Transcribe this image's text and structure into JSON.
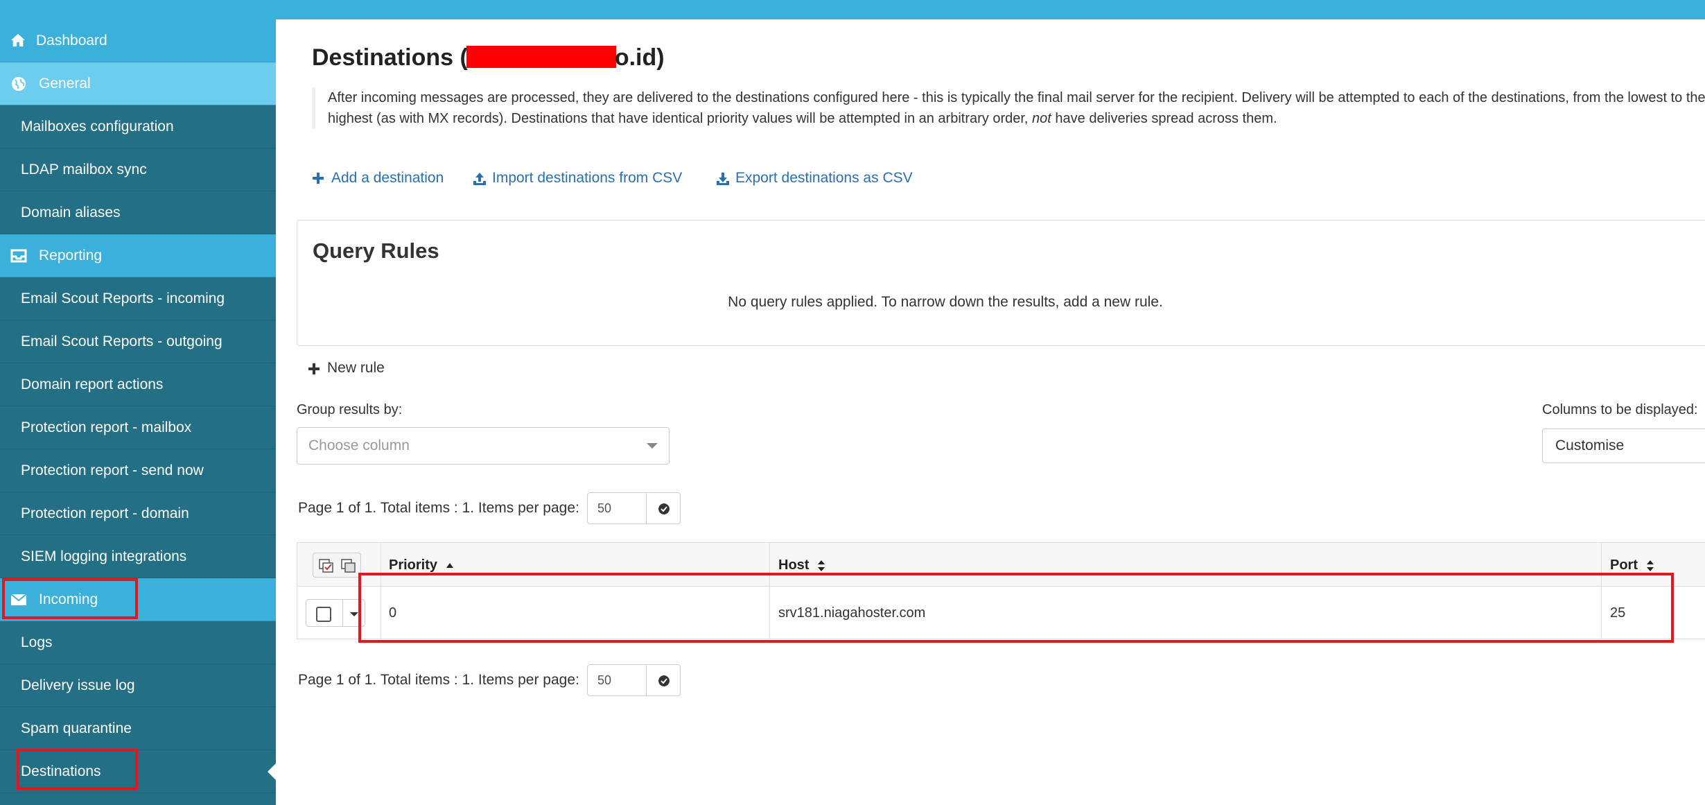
{
  "sidebar": {
    "dashboard": "Dashboard",
    "general": "General",
    "mailboxes_configuration": "Mailboxes configuration",
    "ldap_mailbox_sync": "LDAP mailbox sync",
    "domain_aliases": "Domain aliases",
    "reporting": "Reporting",
    "email_scout_incoming": "Email Scout Reports - incoming",
    "email_scout_outgoing": "Email Scout Reports - outgoing",
    "domain_report_actions": "Domain report actions",
    "protection_report_mailbox": "Protection report - mailbox",
    "protection_report_send_now": "Protection report - send now",
    "protection_report_domain": "Protection report - domain",
    "siem_logging": "SIEM logging integrations",
    "incoming": "Incoming",
    "logs": "Logs",
    "delivery_issue_log": "Delivery issue log",
    "spam_quarantine": "Spam quarantine",
    "destinations": "Destinations"
  },
  "page": {
    "title_prefix": "Destinations (",
    "title_suffix": "o.id)",
    "desc_line1_pre": "After incoming messages are processed, they are delivered to the destinations configured here - this is typically the final mail server for the recipient. Delivery will be attempted to each of the destinations, from the lowest to the",
    "desc_line2_pre": "highest (as with MX records). Destinations that have identical priority values will be attempted in an arbitrary order, ",
    "desc_line2_em": "not",
    "desc_line2_post": " have deliveries spread across them."
  },
  "actions": {
    "add": "Add a destination",
    "import": "Import destinations from CSV",
    "export": "Export destinations as CSV"
  },
  "query_rules": {
    "title": "Query Rules",
    "empty": "No query rules applied. To narrow down the results, add a new rule.",
    "new_rule": "New rule"
  },
  "group": {
    "label": "Group results by:",
    "placeholder": "Choose column"
  },
  "columns": {
    "label": "Columns to be displayed:",
    "value": "Customise"
  },
  "pager": {
    "text": "Page 1 of 1. Total items : 1. Items per page:",
    "per_page": "50"
  },
  "table": {
    "headers": {
      "priority": "Priority",
      "host": "Host",
      "port": "Port"
    },
    "rows": [
      {
        "priority": "0",
        "host": "srv181.niagahoster.com",
        "port": "25"
      }
    ]
  },
  "colors": {
    "topbar": "#3ab0db",
    "sidebar": "#236f86",
    "section": "#3ab0db",
    "section_active": "#6dcdee",
    "link": "#2a6fb0",
    "highlight": "#e5161e"
  }
}
